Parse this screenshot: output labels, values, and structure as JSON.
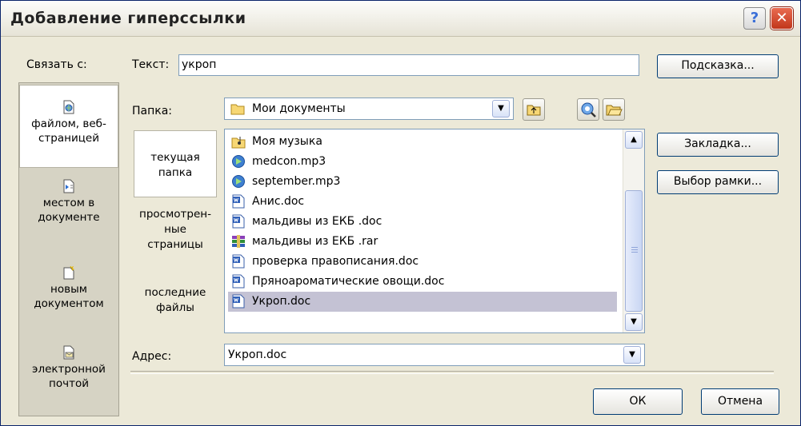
{
  "window": {
    "title": "Добавление гиперссылки",
    "help": "?",
    "close": "✕"
  },
  "link_to": {
    "label": "Связать с:",
    "items": [
      {
        "label": "файлом, веб-\nстраницей",
        "icon": "web-page-icon"
      },
      {
        "label": "местом в\nдокументе",
        "icon": "place-in-document-icon"
      },
      {
        "label": "новым\nдокументом",
        "icon": "new-document-icon"
      },
      {
        "label": "электронной\nпочтой",
        "icon": "email-icon"
      }
    ]
  },
  "text_field": {
    "label": "Текст:",
    "value": "укроп"
  },
  "buttons": {
    "screen_tip": "Подсказка...",
    "bookmark": "Закладка...",
    "target_frame": "Выбор рамки...",
    "ok": "ОК",
    "cancel": "Отмена"
  },
  "folder": {
    "label": "Папка:",
    "value": "Мои документы"
  },
  "places": [
    {
      "label": "текущая\nпапка"
    },
    {
      "label": "просмотрен-\nные\nстраницы"
    },
    {
      "label": "последние\nфайлы"
    }
  ],
  "files": [
    {
      "name": "Моя музыка",
      "icon": "music-folder-icon"
    },
    {
      "name": "medcon.mp3",
      "icon": "mp3-file-icon"
    },
    {
      "name": "september.mp3",
      "icon": "mp3-file-icon"
    },
    {
      "name": "Анис.doc",
      "icon": "word-doc-icon"
    },
    {
      "name": "мальдивы из ЕКБ .doc",
      "icon": "word-doc-icon"
    },
    {
      "name": "мальдивы из ЕКБ .rar",
      "icon": "rar-archive-icon"
    },
    {
      "name": "проверка правописания.doc",
      "icon": "word-doc-icon"
    },
    {
      "name": "Пряноароматические овощи.doc",
      "icon": "word-doc-icon"
    },
    {
      "name": "Укроп.doc",
      "icon": "word-doc-icon",
      "selected": true
    }
  ],
  "address": {
    "label": "Адрес:",
    "value": "Укроп.doc"
  },
  "colors": {
    "selection": "#c4c2d4",
    "title_text": "#222222",
    "accent_border": "#7f9db9"
  }
}
